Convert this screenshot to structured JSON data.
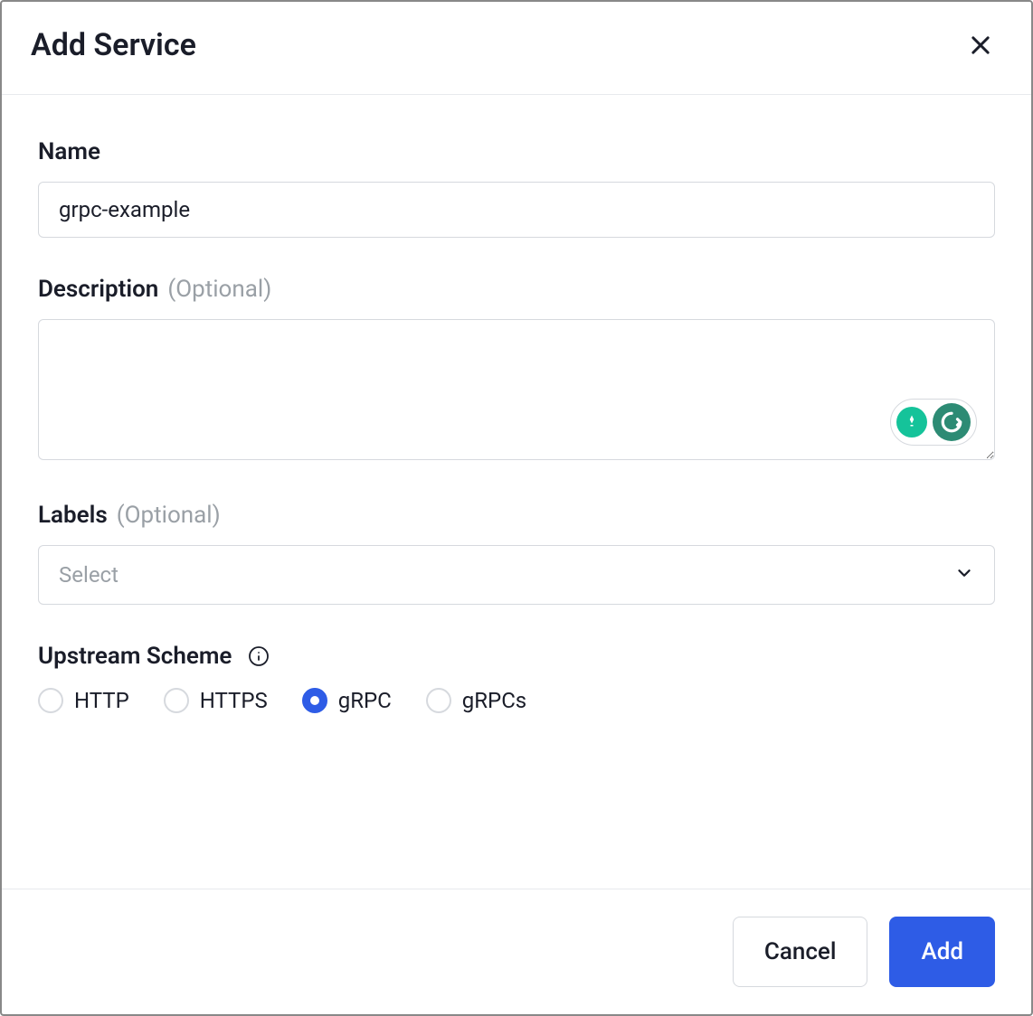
{
  "modal": {
    "title": "Add Service"
  },
  "fields": {
    "name": {
      "label": "Name",
      "value": "grpc-example"
    },
    "description": {
      "label": "Description",
      "optional": "(Optional)",
      "value": ""
    },
    "labels": {
      "label": "Labels",
      "optional": "(Optional)",
      "placeholder": "Select"
    },
    "upstream_scheme": {
      "label": "Upstream Scheme",
      "options": [
        "HTTP",
        "HTTPS",
        "gRPC",
        "gRPCs"
      ],
      "selected": "gRPC"
    }
  },
  "footer": {
    "cancel": "Cancel",
    "add": "Add"
  }
}
